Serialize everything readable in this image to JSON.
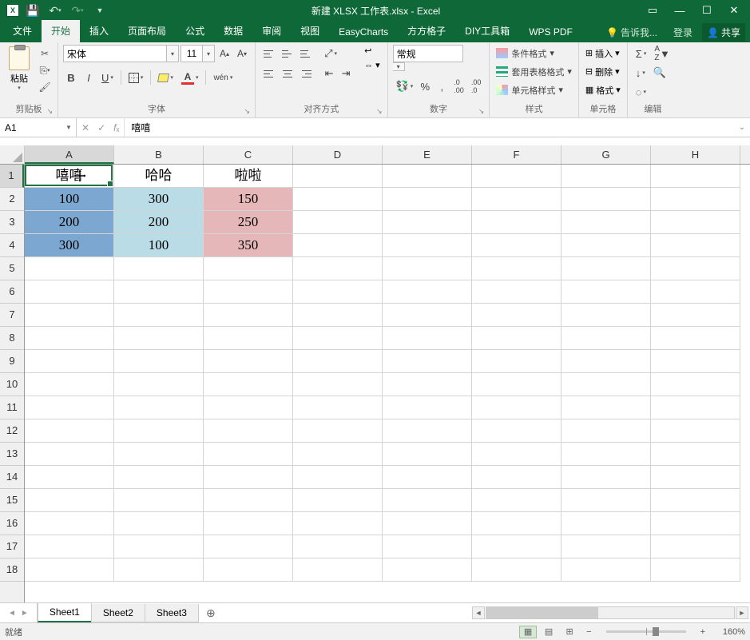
{
  "title": "新建 XLSX 工作表.xlsx - Excel",
  "tabs": {
    "file": "文件",
    "home": "开始",
    "insert": "插入",
    "layout": "页面布局",
    "formulas": "公式",
    "data": "数据",
    "review": "审阅",
    "view": "视图",
    "easycharts": "EasyCharts",
    "fangfang": "方方格子",
    "diy": "DIY工具箱",
    "wpspdf": "WPS PDF",
    "tell": "告诉我...",
    "login": "登录",
    "share": "共享"
  },
  "ribbon": {
    "clipboard": {
      "paste": "粘贴",
      "label": "剪贴板"
    },
    "font": {
      "name": "宋体",
      "size": "11",
      "pinyin": "wén",
      "label": "字体"
    },
    "align": {
      "label": "对齐方式"
    },
    "number": {
      "format": "常规",
      "label": "数字"
    },
    "styles": {
      "cond": "条件格式",
      "table": "套用表格格式",
      "cell": "单元格样式",
      "label": "样式"
    },
    "cells": {
      "insert": "插入",
      "delete": "删除",
      "format": "格式",
      "label": "单元格"
    },
    "editing": {
      "label": "编辑"
    }
  },
  "namebox": "A1",
  "formula": "嘻嘻",
  "columns": [
    "A",
    "B",
    "C",
    "D",
    "E",
    "F",
    "G",
    "H"
  ],
  "rows": [
    "1",
    "2",
    "3",
    "4",
    "5",
    "6",
    "7",
    "8",
    "9",
    "10",
    "11",
    "12",
    "13",
    "14",
    "15",
    "16",
    "17",
    "18"
  ],
  "data": {
    "r1": [
      "嘻嘻",
      "哈哈",
      "啦啦"
    ],
    "r2": [
      "100",
      "300",
      "150"
    ],
    "r3": [
      "200",
      "200",
      "250"
    ],
    "r4": [
      "300",
      "100",
      "350"
    ]
  },
  "sheets": [
    "Sheet1",
    "Sheet2",
    "Sheet3"
  ],
  "status": "就绪",
  "zoom": "160%",
  "chart_data": {
    "type": "table",
    "columns": [
      "嘻嘻",
      "哈哈",
      "啦啦"
    ],
    "rows": [
      [
        100,
        300,
        150
      ],
      [
        200,
        200,
        250
      ],
      [
        300,
        100,
        350
      ]
    ]
  }
}
